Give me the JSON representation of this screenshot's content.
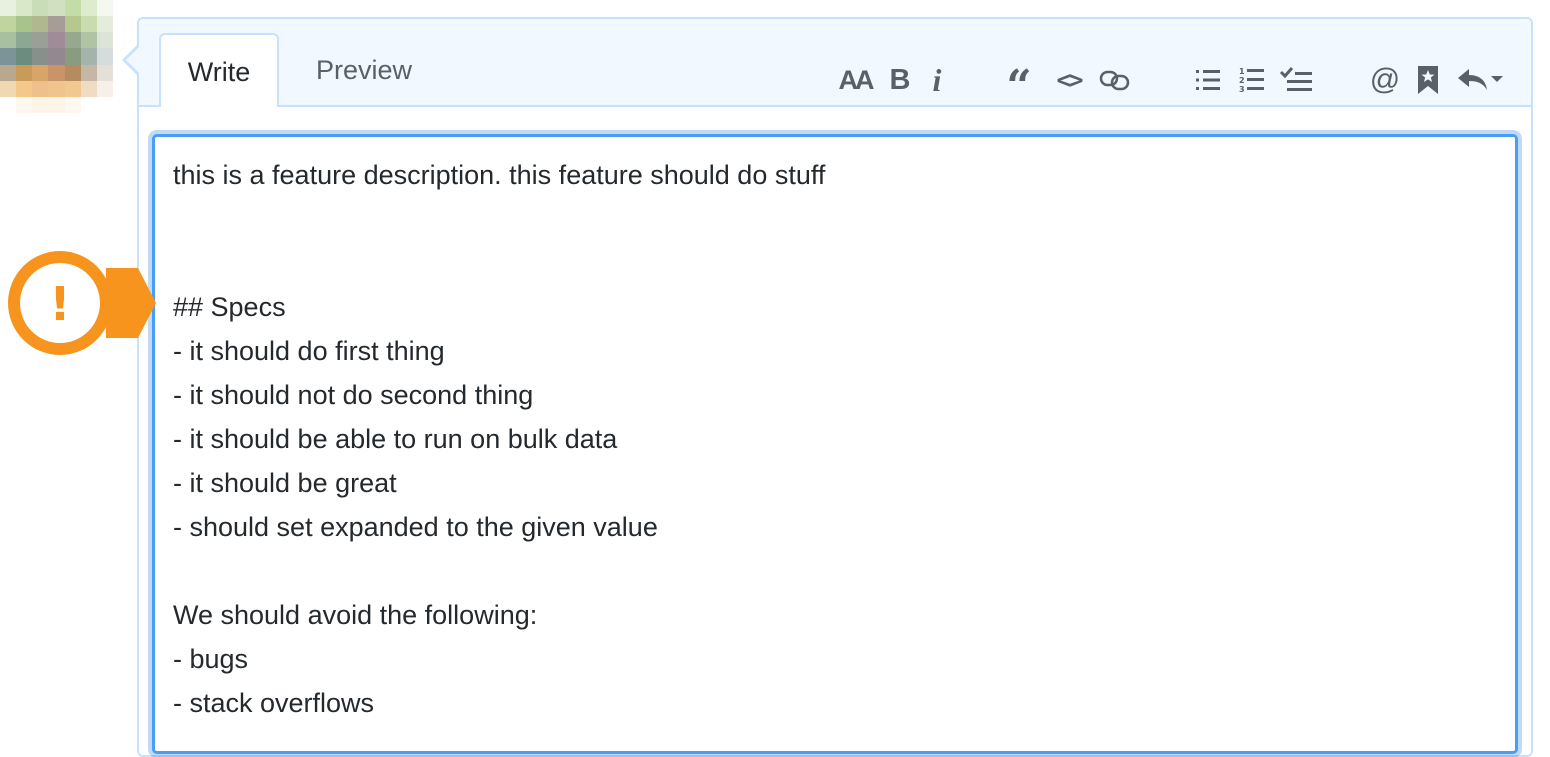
{
  "tabs": {
    "write_label": "Write",
    "preview_label": "Preview"
  },
  "toolbar": {
    "text_size_label": "AA",
    "bold_label": "B",
    "italic_label": "i",
    "quote_label": "“",
    "code_label": "<>",
    "mention_label": "@",
    "icons": [
      "text-size-icon",
      "bold-icon",
      "italic-icon",
      "quote-icon",
      "code-icon",
      "link-icon",
      "bulleted-list-icon",
      "numbered-list-icon",
      "task-list-icon",
      "mention-icon",
      "saved-reply-icon",
      "reply-dropdown-icon"
    ]
  },
  "editor": {
    "lines": [
      "this is a feature description. this feature should do stuff",
      "",
      "",
      "## Specs",
      "- it should do first thing",
      "- it should not do second thing",
      "- it should be able to run on bulk data",
      "- it should be great",
      "- should set expanded to the given value",
      "",
      "We should avoid the following:",
      "- bugs",
      "- stack overflows"
    ]
  },
  "colors": {
    "border": "#c8e1ff",
    "tabbar_bg": "#f1f8ff",
    "focus_border": "#4a9df5",
    "warning_orange": "#f7941d"
  },
  "callout": {
    "icon": "exclamation-icon",
    "symbol": "!"
  }
}
